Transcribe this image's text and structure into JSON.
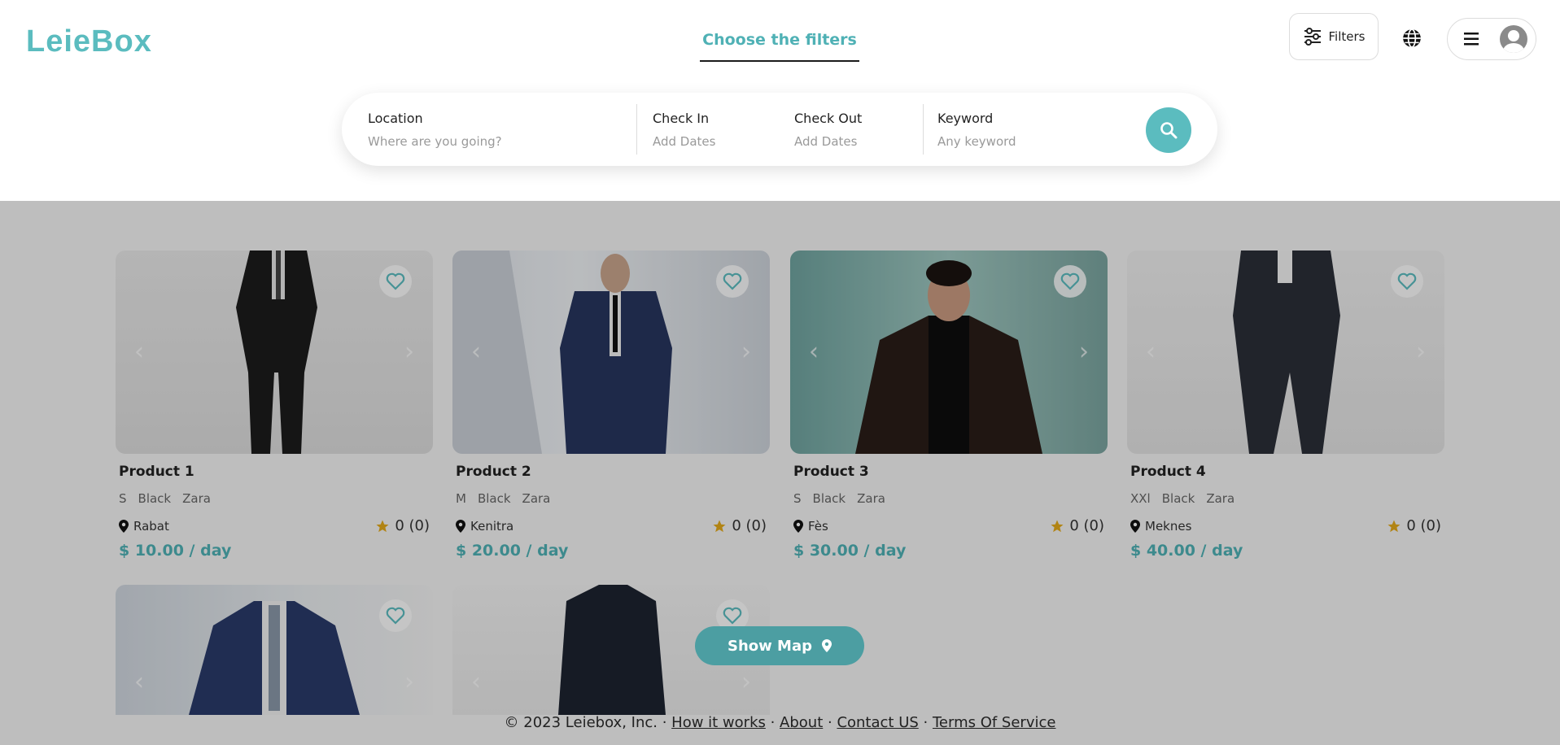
{
  "header": {
    "logo_text": "LeieBox",
    "center_tab": "Choose the filters",
    "filters_label": "Filters"
  },
  "search": {
    "location": {
      "label": "Location",
      "placeholder": "Where are you going?"
    },
    "check_in": {
      "label": "Check In",
      "placeholder": "Add Dates"
    },
    "check_out": {
      "label": "Check Out",
      "placeholder": "Add Dates"
    },
    "keyword": {
      "label": "Keyword",
      "placeholder": "Any keyword"
    }
  },
  "products": [
    {
      "title": "Product 1",
      "size": "S",
      "color": "Black",
      "brand": "Zara",
      "location": "Rabat",
      "rating": "0 (0)",
      "price": "$ 10.00 / day"
    },
    {
      "title": "Product 2",
      "size": "M",
      "color": "Black",
      "brand": "Zara",
      "location": "Kenitra",
      "rating": "0 (0)",
      "price": "$ 20.00 / day"
    },
    {
      "title": "Product 3",
      "size": "S",
      "color": "Black",
      "brand": "Zara",
      "location": "Fès",
      "rating": "0 (0)",
      "price": "$ 30.00 / day"
    },
    {
      "title": "Product 4",
      "size": "XXl",
      "color": "Black",
      "brand": "Zara",
      "location": "Meknes",
      "rating": "0 (0)",
      "price": "$ 40.00 / day"
    }
  ],
  "show_map_label": "Show Map",
  "footer": {
    "copyright": "© 2023 Leiebox, Inc.",
    "links": [
      "How it works",
      "About",
      "Contact US",
      "Terms Of Service"
    ]
  },
  "colors": {
    "accent": "#5bbcbf",
    "price": "#4fb1b5",
    "star": "#e3a91a"
  }
}
